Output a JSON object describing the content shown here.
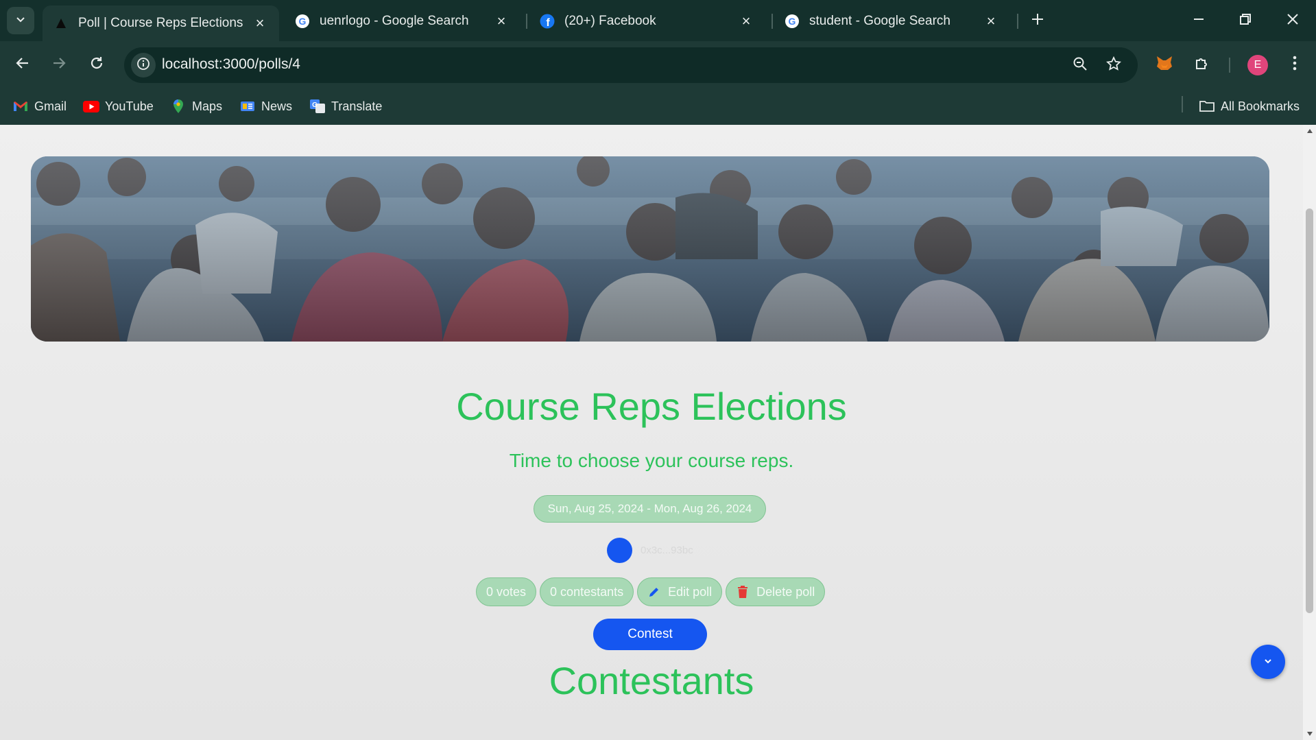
{
  "browser": {
    "tabs": [
      {
        "title": "Poll | Course Reps Elections",
        "favicon": "triangle-icon",
        "active": true
      },
      {
        "title": "uenrlogo - Google Search",
        "favicon": "google-icon",
        "active": false
      },
      {
        "title": "(20+) Facebook",
        "favicon": "facebook-icon",
        "active": false
      },
      {
        "title": "student - Google Search",
        "favicon": "google-icon",
        "active": false
      }
    ],
    "url": "localhost:3000/polls/4",
    "profile_initial": "E",
    "bookmarks": [
      {
        "label": "Gmail",
        "icon": "gmail-icon"
      },
      {
        "label": "YouTube",
        "icon": "youtube-icon"
      },
      {
        "label": "Maps",
        "icon": "maps-icon"
      },
      {
        "label": "News",
        "icon": "news-icon"
      },
      {
        "label": "Translate",
        "icon": "translate-icon"
      }
    ],
    "all_bookmarks": "All Bookmarks"
  },
  "poll": {
    "title": "Course Reps Elections",
    "description": "Time to choose your course reps.",
    "dates": "Sun, Aug 25, 2024 - Mon, Aug 26, 2024",
    "owner_address": "0x3c...93bc",
    "votes": "0 votes",
    "contestants_count": "0 contestants",
    "edit_label": "Edit poll",
    "delete_label": "Delete poll",
    "contest_label": "Contest",
    "contestants_heading": "Contestants"
  },
  "colors": {
    "accent_green": "#2cc25a",
    "accent_blue": "#1556f0",
    "delete_red": "#e53935",
    "chrome_bg": "#1e3a36"
  }
}
